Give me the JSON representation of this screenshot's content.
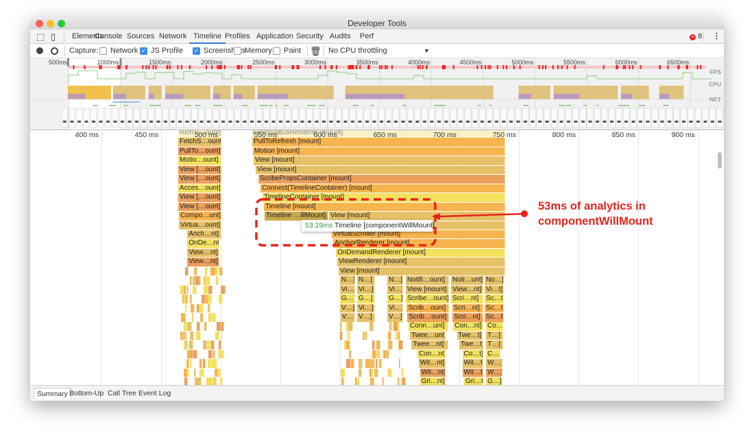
{
  "window": {
    "title": "Developer Tools"
  },
  "tabs": [
    {
      "label": "Elements"
    },
    {
      "label": "Console"
    },
    {
      "label": "Sources"
    },
    {
      "label": "Network"
    },
    {
      "label": "Timeline",
      "active": true
    },
    {
      "label": "Profiles"
    },
    {
      "label": "Application"
    },
    {
      "label": "Security"
    },
    {
      "label": "Audits"
    },
    {
      "label": "Perf"
    }
  ],
  "error_count": "8",
  "toolbar": {
    "capture_label": "Capture:",
    "options": [
      {
        "label": "Network",
        "checked": false
      },
      {
        "label": "JS Profile",
        "checked": true
      },
      {
        "label": "Screenshots",
        "checked": true
      },
      {
        "label": "Memory",
        "checked": false
      },
      {
        "label": "Paint",
        "checked": false
      }
    ],
    "throttling": "No CPU throttling"
  },
  "overview": {
    "ticks": [
      "500ms",
      "1000ms",
      "1500ms",
      "2000ms",
      "2500ms",
      "3000ms",
      "3500ms",
      "4000ms",
      "4500ms",
      "5000ms",
      "5500ms",
      "6000ms",
      "6500ms"
    ],
    "track_labels": [
      "FPS",
      "CPU",
      "NET"
    ],
    "selection_ms": [
      500,
      1000
    ],
    "cpu_busy_ms": [
      [
        493,
        910
      ],
      [
        930,
        1240
      ],
      [
        1273,
        1399
      ],
      [
        1432,
        1868
      ],
      [
        1895,
        2066
      ],
      [
        2093,
        2298
      ],
      [
        2324,
        3058
      ],
      [
        3170,
        4598
      ],
      [
        4843,
        5148
      ],
      [
        5181,
        5800
      ],
      [
        5830,
        6100
      ],
      [
        6200,
        6435
      ]
    ]
  },
  "flame": {
    "ticks": [
      {
        "ms": 400,
        "label": "400 ms"
      },
      {
        "ms": 450,
        "label": "450 ms"
      },
      {
        "ms": 500,
        "label": "500 ms"
      },
      {
        "ms": 550,
        "label": "550 ms"
      },
      {
        "ms": 600,
        "label": "600 ms"
      },
      {
        "ms": 650,
        "label": "650 ms"
      },
      {
        "ms": 700,
        "label": "700 ms"
      },
      {
        "ms": 750,
        "label": "750 ms"
      },
      {
        "ms": 800,
        "label": "800 ms"
      },
      {
        "ms": 850,
        "label": "850 ms"
      },
      {
        "ms": 900,
        "label": "900 ms"
      }
    ],
    "colors": {
      "y": "#f2e05e",
      "o": "#f7b44f",
      "t": "#e6c168",
      "d": "#eba05c",
      "s": "#c9ab4c",
      "l": "#f5e99a"
    },
    "bars": [
      [
        464.4,
        500.6,
        0,
        "RichTi…ount]",
        "l"
      ],
      [
        464.4,
        500.6,
        1,
        "FetchS…ount]",
        "t"
      ],
      [
        464.4,
        500.6,
        2,
        "PullTo…ount]",
        "d"
      ],
      [
        464.4,
        500.6,
        3,
        "Motio…ount]",
        "y"
      ],
      [
        464.4,
        500.6,
        4,
        "View […ount]",
        "d"
      ],
      [
        464.4,
        500.6,
        5,
        "View […ount]",
        "d"
      ],
      [
        464.4,
        500.6,
        6,
        "Acces…ount]",
        "y"
      ],
      [
        464.4,
        500.6,
        7,
        "View […ount]",
        "d"
      ],
      [
        464.4,
        500.6,
        8,
        "View […ount]",
        "d"
      ],
      [
        465,
        500.6,
        9,
        "Compo…unt]",
        "o"
      ],
      [
        465,
        500.6,
        10,
        "Virtua…ount]",
        "t"
      ],
      [
        472,
        500.6,
        11,
        "Anch…nt]",
        "t"
      ],
      [
        472,
        498.9,
        12,
        "OnDe…nt]",
        "y"
      ],
      [
        472,
        498.9,
        13,
        "View…nt]",
        "t"
      ],
      [
        472,
        498.9,
        14,
        "View…nt]",
        "d"
      ],
      [
        525.9,
        738.5,
        0,
        "FetchStatusRenderer [mount]",
        "l"
      ],
      [
        526.4,
        738.5,
        1,
        "PullToRefresh [mount]",
        "o"
      ],
      [
        527,
        738.5,
        2,
        "Motion [mount]",
        "o"
      ],
      [
        527.6,
        738.5,
        3,
        "View [mount]",
        "t"
      ],
      [
        529.3,
        738.5,
        4,
        "View [mount]",
        "t"
      ],
      [
        531.6,
        738.5,
        5,
        "ScribePropsContainer [mount]",
        "d"
      ],
      [
        533.3,
        738.5,
        6,
        "Connect(TimelineContainer) [mount]",
        "o"
      ],
      [
        535.1,
        738.5,
        7,
        "TimelineContainer [mount]",
        "y"
      ],
      [
        536.2,
        738.5,
        8,
        "Timeline [mount]",
        "o"
      ],
      [
        536.8,
        590.2,
        9,
        "Timeline …illMount]",
        "s"
      ],
      [
        590.8,
        738.5,
        9,
        "View [mount]",
        "t"
      ],
      [
        590.8,
        738.5,
        10,
        "",
        "t"
      ],
      [
        593.1,
        738.5,
        11,
        "VirtualScroller [mount]",
        "o"
      ],
      [
        594.3,
        738.5,
        12,
        "AnchorRenderer [mount]",
        "o"
      ],
      [
        596.6,
        738.5,
        13,
        "OnDemandRenderer [mount]",
        "y"
      ],
      [
        597.7,
        738.5,
        14,
        "ViewRenderer [mount]",
        "t"
      ],
      [
        598.9,
        738.5,
        15,
        "View [mount]",
        "t"
      ],
      [
        600,
        612.6,
        16,
        "N…]",
        "t"
      ],
      [
        614.4,
        629.3,
        16,
        "N…]",
        "t"
      ],
      [
        639.7,
        652.9,
        16,
        "N…]",
        "t"
      ],
      [
        655.2,
        691.4,
        16,
        "Notifi…ount]",
        "t"
      ],
      [
        693.1,
        720.1,
        16,
        "Noti…unt]",
        "t"
      ],
      [
        721.3,
        737.4,
        16,
        "No…]",
        "t"
      ],
      [
        600,
        612.6,
        17,
        "Vi…]",
        "t"
      ],
      [
        614.4,
        629.3,
        17,
        "Vi…]",
        "t"
      ],
      [
        639.7,
        652.9,
        17,
        "Vi…]",
        "t"
      ],
      [
        655.2,
        691.4,
        17,
        "View [mount]",
        "t"
      ],
      [
        693.1,
        720.1,
        17,
        "View…nt]",
        "t"
      ],
      [
        721.3,
        737.4,
        17,
        "Vi…t]",
        "t"
      ],
      [
        600,
        612.6,
        18,
        "G…]",
        "y"
      ],
      [
        614.4,
        629.3,
        18,
        "G…]",
        "y"
      ],
      [
        639.7,
        652.9,
        18,
        "G…]",
        "y"
      ],
      [
        655.2,
        691.4,
        18,
        "Scribe…ount]",
        "y"
      ],
      [
        693.1,
        720.1,
        18,
        "Scri…nt]",
        "y"
      ],
      [
        721.3,
        737.4,
        18,
        "Sc…t]",
        "y"
      ],
      [
        600,
        612.6,
        19,
        "V…]",
        "t"
      ],
      [
        614.4,
        629.3,
        19,
        "Vi…]",
        "t"
      ],
      [
        639.7,
        652.9,
        19,
        "Vi…]",
        "t"
      ],
      [
        656,
        691.4,
        19,
        "Scrib…ount]",
        "o"
      ],
      [
        694,
        720.1,
        19,
        "Scri…nt]",
        "o"
      ],
      [
        721.3,
        737.4,
        19,
        "Sc…t]",
        "o"
      ],
      [
        600.5,
        612.6,
        20,
        "V…",
        "t"
      ],
      [
        614.4,
        629.3,
        20,
        "V…]",
        "t"
      ],
      [
        639.7,
        652.9,
        20,
        "V…]",
        "t"
      ],
      [
        656.5,
        691.4,
        20,
        "Scrib…ount]",
        "d"
      ],
      [
        694.5,
        720.1,
        20,
        "Scri…nt]",
        "d"
      ],
      [
        721.3,
        737.4,
        20,
        "Sc…t]",
        "d"
      ],
      [
        657.5,
        691,
        21,
        "Conn…unt]",
        "y"
      ],
      [
        695,
        720,
        21,
        "Con…nt]",
        "y"
      ],
      [
        722.5,
        737,
        21,
        "Co…]",
        "y"
      ],
      [
        658.7,
        688.5,
        22,
        "Twee…unt]",
        "t"
      ],
      [
        698,
        719.5,
        22,
        "Twe…t]",
        "t"
      ],
      [
        722.5,
        737,
        22,
        "T…]",
        "t"
      ],
      [
        660,
        691,
        23,
        "Twee…nt]",
        "t"
      ],
      [
        700,
        720,
        23,
        "Twe…t]",
        "t"
      ],
      [
        722.5,
        737,
        23,
        "T…]",
        "t"
      ],
      [
        665,
        688.5,
        24,
        "Con…nt]",
        "y"
      ],
      [
        702.6,
        720,
        24,
        "Co…t]",
        "y"
      ],
      [
        722.5,
        734.5,
        24,
        "C…]",
        "y"
      ],
      [
        666,
        688.5,
        25,
        "Wit…nt]",
        "t"
      ],
      [
        702.6,
        720,
        25,
        "Wit…t]",
        "t"
      ],
      [
        722.5,
        736,
        25,
        "W…]",
        "t"
      ],
      [
        667,
        688.5,
        26,
        "Wit…nt]",
        "d"
      ],
      [
        702.6,
        720,
        26,
        "Wit…t]",
        "d"
      ],
      [
        722.5,
        736,
        26,
        "W…]",
        "d"
      ],
      [
        667,
        688.5,
        27,
        "Gri…nt]",
        "y"
      ],
      [
        704,
        720,
        27,
        "Gri…t]",
        "y"
      ],
      [
        722.5,
        736,
        27,
        "G…]",
        "y"
      ]
    ],
    "tooltip": {
      "duration": "53.19ms",
      "name": "Timeline [componentWillMount]"
    }
  },
  "annotation": {
    "text": "53ms of analytics in\ncomponentWillMount",
    "color": "#e8231a"
  },
  "bottom_tabs": [
    {
      "label": "Summary",
      "active": true
    },
    {
      "label": "Bottom-Up"
    },
    {
      "label": "Call Tree"
    },
    {
      "label": "Event Log"
    }
  ]
}
